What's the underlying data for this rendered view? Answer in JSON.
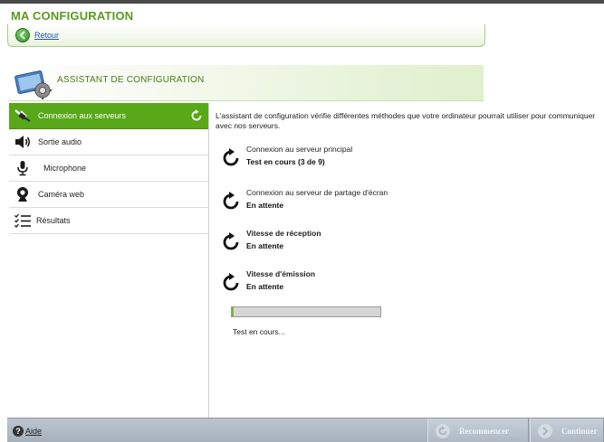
{
  "title": "MA CONFIGURATION",
  "back": {
    "label": "Retour"
  },
  "header": {
    "title": "ASSISTANT DE CONFIGURATION",
    "icon": "wizard-icon"
  },
  "sidebar": {
    "items": [
      {
        "label": "Connexion aux serveurs",
        "icon": "server-connection-icon",
        "active": true
      },
      {
        "label": "Sortie audio",
        "icon": "speaker-icon"
      },
      {
        "label": "Microphone",
        "icon": "microphone-icon"
      },
      {
        "label": "Caméra web",
        "icon": "webcam-icon"
      },
      {
        "label": "Résultats",
        "icon": "results-list-icon"
      }
    ]
  },
  "main": {
    "intro": "L'assistant de configuration vérifie différentes méthodes que votre ordinateur pourrait utiliser pour communiquer avec nos serveurs.",
    "tests": [
      {
        "name": "Connexion au serveur principal",
        "status": "Test en cours (3 de 9)"
      },
      {
        "name": "Connexion au serveur de partage d'écran",
        "status": "En attente"
      },
      {
        "name": "Vitesse de réception",
        "status": "En attente"
      },
      {
        "name": "Vitesse d'émission",
        "status": "En attente"
      }
    ],
    "progress_fraction": 0.01,
    "progress_text": "Test en cours..."
  },
  "footer": {
    "help_label": "Aide",
    "restart_label": "Recommencer",
    "continue_label": "Continuer"
  },
  "colors": {
    "accent": "#58a819",
    "title_green": "#5a9a1e",
    "footer_gray": "#a7b1bc"
  }
}
